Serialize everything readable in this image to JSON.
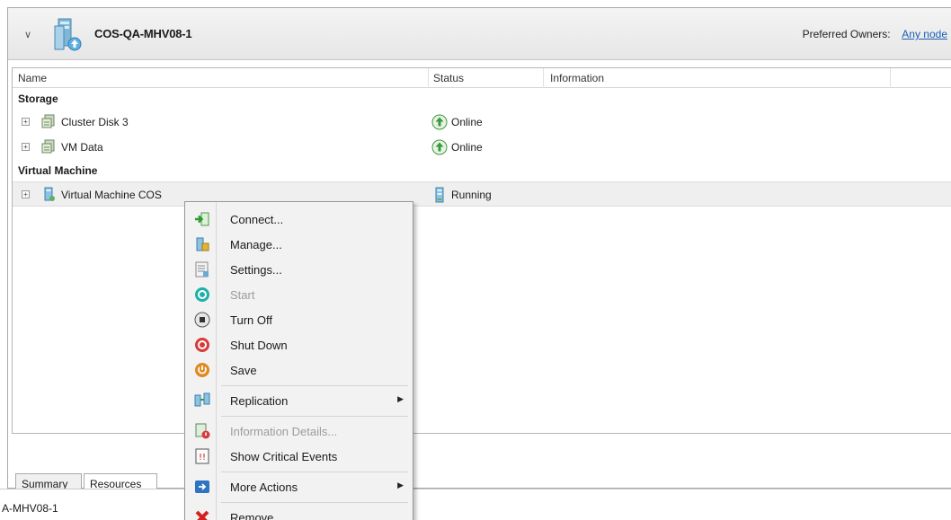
{
  "role": {
    "title": "COS-QA-MHV08-1",
    "preferred_owners_label": "Preferred Owners:",
    "preferred_owners_value": "Any node"
  },
  "columns": [
    "Name",
    "Status",
    "Information"
  ],
  "groups": {
    "storage": "Storage",
    "virtual_machine": "Virtual Machine"
  },
  "rows": [
    {
      "name": "Cluster Disk 3",
      "status": "Online"
    },
    {
      "name": "VM Data",
      "status": "Online"
    },
    {
      "name": "Virtual Machine COS",
      "status": "Running"
    }
  ],
  "tabs": [
    "Summary",
    "Resources"
  ],
  "bottom_text": "A-MHV08-1",
  "context_menu": [
    {
      "label": "Connect...",
      "icon": "connect-icon",
      "disabled": false
    },
    {
      "label": "Manage...",
      "icon": "manage-icon",
      "disabled": false
    },
    {
      "label": "Settings...",
      "icon": "settings-icon",
      "disabled": false
    },
    {
      "label": "Start",
      "icon": "start-icon",
      "disabled": true
    },
    {
      "label": "Turn Off",
      "icon": "turn-off-icon",
      "disabled": false
    },
    {
      "label": "Shut Down",
      "icon": "shut-down-icon",
      "disabled": false
    },
    {
      "label": "Save",
      "icon": "save-icon",
      "disabled": false
    },
    {
      "label": "Replication",
      "icon": "replication-icon",
      "disabled": false,
      "submenu": true
    },
    {
      "label": "Information Details...",
      "icon": "information-details-icon",
      "disabled": true
    },
    {
      "label": "Show Critical Events",
      "icon": "critical-events-icon",
      "disabled": false
    },
    {
      "label": "More Actions",
      "icon": "more-actions-icon",
      "disabled": false,
      "submenu": true
    },
    {
      "label": "Remove",
      "icon": "remove-icon",
      "disabled": false
    }
  ],
  "colors": {
    "link": "#1a5fb4",
    "online_green": "#3a9a3a",
    "shutdown_red": "#d93a3a",
    "save_orange": "#e08a1e",
    "start_teal": "#1fb0a8",
    "remove_red": "#d42020"
  }
}
